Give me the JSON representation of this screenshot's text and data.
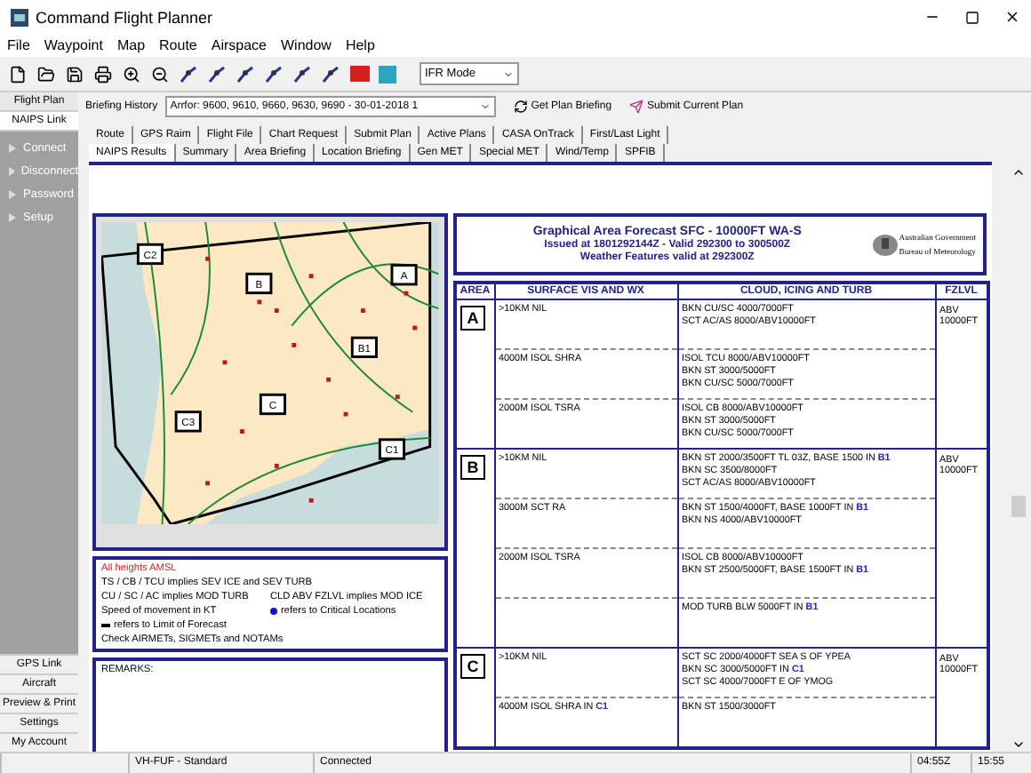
{
  "window": {
    "title": "Command Flight Planner"
  },
  "menu": [
    "File",
    "Waypoint",
    "Map",
    "Route",
    "Airspace",
    "Window",
    "Help"
  ],
  "toolbar": {
    "mode_select": "IFR Mode"
  },
  "sidebar": {
    "tabs": [
      {
        "label": "Flight Plan",
        "selected": false
      },
      {
        "label": "NAIPS Link",
        "selected": true
      }
    ],
    "items": [
      "Connect",
      "Disconnect",
      "Password",
      "Setup"
    ],
    "bottom_buttons": [
      "GPS Link",
      "Aircraft",
      "Preview & Print",
      "Settings",
      "My Account"
    ]
  },
  "briefing": {
    "history_label": "Briefing History",
    "history_value": "Arrfor: 9600, 9610, 9660, 9630, 9690 - 30-01-2018 1",
    "buttons": [
      "Get Plan Briefing",
      "Submit Current Plan"
    ]
  },
  "tab_rows": [
    [
      {
        "label": "Route",
        "selected": false
      },
      {
        "label": "GPS Raim",
        "selected": false
      },
      {
        "label": "Flight File",
        "selected": false
      },
      {
        "label": "Chart Request",
        "selected": false
      },
      {
        "label": "Submit Plan",
        "selected": false
      },
      {
        "label": "Active Plans",
        "selected": false
      },
      {
        "label": "CASA OnTrack",
        "selected": false
      },
      {
        "label": "First/Last Light",
        "selected": false
      }
    ],
    [
      {
        "label": "NAIPS Results",
        "selected": true
      },
      {
        "label": "Summary",
        "selected": false
      },
      {
        "label": "Area Briefing",
        "selected": false
      },
      {
        "label": "Location Briefing",
        "selected": false
      },
      {
        "label": "Gen MET",
        "selected": false
      },
      {
        "label": "Special MET",
        "selected": false
      },
      {
        "label": "Wind/Temp",
        "selected": false
      },
      {
        "label": "SPFIB",
        "selected": false
      }
    ]
  ],
  "map": {
    "labels": [
      "C2",
      "B",
      "A",
      "B1",
      "C",
      "C3",
      "C1"
    ]
  },
  "legend": {
    "warning": "All heights AMSL",
    "lines": [
      {
        "kind": "text",
        "text": "TS / CB / TCU implies SEV ICE and SEV TURB"
      },
      {
        "kind": "text",
        "text": "CU / SC / AC implies MOD TURB"
      },
      {
        "kind": "text",
        "text": "CLD ABV FZLVL implies MOD ICE"
      },
      {
        "kind": "text",
        "text": "Speed of movement in KT"
      },
      {
        "kind": "dot",
        "text": "refers to Critical Locations"
      },
      {
        "kind": "dash",
        "text": "refers to Limit of Forecast"
      },
      {
        "kind": "text",
        "text": "Check AIRMETs, SIGMETs and NOTAMs"
      }
    ]
  },
  "remarks": "REMARKS:",
  "forecast": {
    "title": "Graphical Area Forecast SFC - 10000FT WA-S",
    "issued": "Issued at 1801292144Z - Valid 292300 to 300500Z",
    "features": "Weather Features valid at 292300Z",
    "agency": [
      "Australian Government",
      "Bureau of Meteorology"
    ]
  },
  "table": {
    "columns": [
      "AREA",
      "SURFACE VIS AND WX",
      "CLOUD, ICING AND TURB",
      "FZLVL"
    ],
    "areas": [
      {
        "label": "A",
        "fzlvl": "ABV 10000FT",
        "rows": [
          {
            "surface": ">10KM NIL",
            "cloud": [
              "BKN CU/SC 4000/7000FT",
              "SCT AC/AS 8000/ABV10000FT"
            ]
          },
          {
            "surface": "4000M ISOL SHRA",
            "cloud": [
              "ISOL TCU 8000/ABV10000FT",
              "BKN ST 3000/5000FT",
              "BKN CU/SC 5000/7000FT"
            ]
          },
          {
            "surface": "2000M ISOL TSRA",
            "cloud": [
              "ISOL CB 8000/ABV10000FT",
              "BKN ST 3000/5000FT",
              "BKN CU/SC 5000/7000FT"
            ]
          }
        ]
      },
      {
        "label": "B",
        "fzlvl": "ABV 10000FT",
        "rows": [
          {
            "surface": ">10KM NIL",
            "cloud": [
              "BKN ST 2000/3500FT TL 03Z, BASE 1500 IN **B1**",
              "BKN SC 3500/8000FT",
              "SCT AC/AS 8000/ABV10000FT"
            ]
          },
          {
            "surface": "3000M SCT RA",
            "cloud": [
              "BKN ST 1500/4000FT, BASE 1000FT IN **B1**",
              "BKN NS 4000/ABV10000FT"
            ]
          },
          {
            "surface": "2000M ISOL TSRA",
            "cloud": [
              "ISOL CB 8000/ABV10000FT",
              "BKN ST 2500/5000FT, BASE 1500FT IN **B1**"
            ]
          },
          {
            "cloud": [
              "MOD TURB BLW 5000FT IN **B1**"
            ]
          }
        ]
      },
      {
        "label": "C",
        "fzlvl": "ABV 10000FT",
        "rows": [
          {
            "surface": ">10KM NIL",
            "cloud": [
              "SCT SC 2000/4000FT SEA S OF YPEA",
              "BKN SC 3000/5000FT IN **C1**",
              "SCT SC 4000/7000FT E OF YMOG"
            ]
          },
          {
            "surface": "4000M ISOL SHRA IN **C1**",
            "cloud": [
              "BKN ST 1500/3000FT"
            ]
          }
        ]
      }
    ]
  },
  "status_bar": [
    "VH-FUF - Standard",
    "Connected",
    "04:55Z",
    "15:55"
  ]
}
